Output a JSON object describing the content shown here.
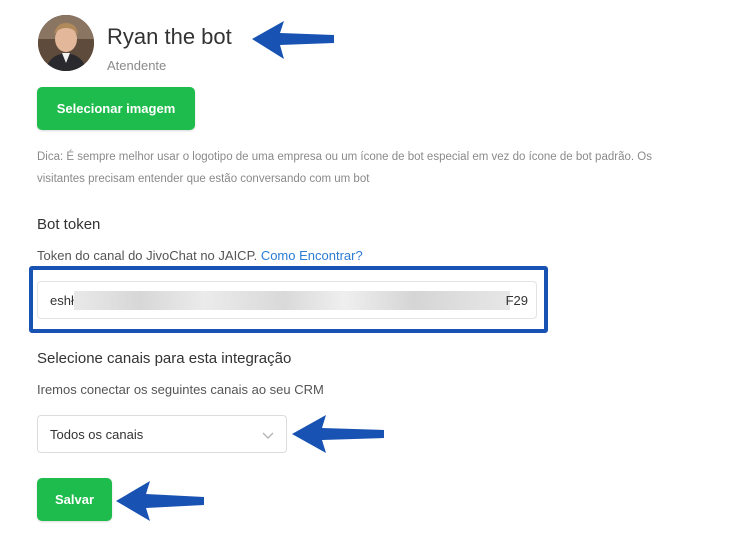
{
  "profile": {
    "name": "Ryan the bot",
    "role": "Atendente",
    "select_image_label": "Selecionar imagem",
    "tip": "Dica: É sempre melhor usar o logotipo de uma empresa ou um ícone de bot especial em vez do ícone de bot padrão. Os visitantes precisam entender que estão conversando com um bot"
  },
  "bot_token": {
    "title": "Bot token",
    "description": "Token do canal do JivoChat no JAICP.",
    "link": "Como Encontrar?",
    "value_prefix": "eshł",
    "value_suffix": "F29"
  },
  "channels": {
    "title": "Selecione canais para esta integração",
    "description": "Iremos conectar os seguintes canais ao seu CRM",
    "selected": "Todos os canais"
  },
  "actions": {
    "save_label": "Salvar"
  },
  "colors": {
    "primary_button": "#1ebc4c",
    "link": "#2b7cd3",
    "annotation": "#1852b2"
  },
  "icons": {
    "dropdown": "chevron-down-icon",
    "annotation_arrows": "arrow-left-icon"
  }
}
